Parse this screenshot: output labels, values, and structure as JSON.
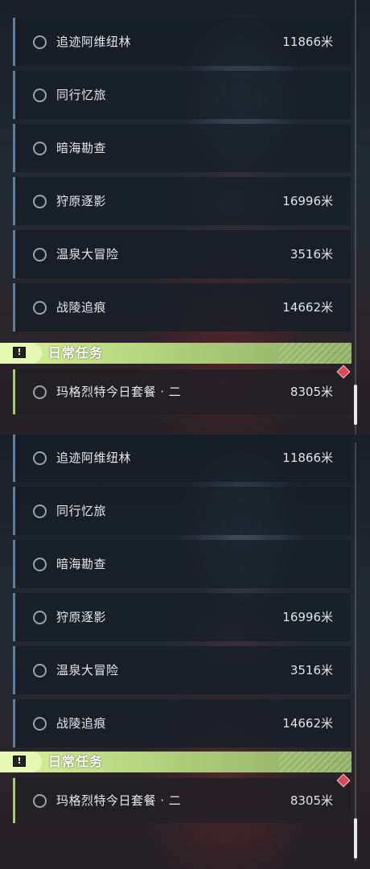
{
  "missions": [
    {
      "name": "追迹阿维纽林",
      "distance": "11866米"
    },
    {
      "name": "同行忆旅",
      "distance": ""
    },
    {
      "name": "暗海勘查",
      "distance": ""
    },
    {
      "name": "狩原逐影",
      "distance": "16996米"
    },
    {
      "name": "温泉大冒险",
      "distance": "3516米"
    },
    {
      "name": "战陵追痕",
      "distance": "14662米"
    }
  ],
  "daily": {
    "title": "日常任务",
    "icon": "exclamation-icon",
    "mission": {
      "name": "玛格烈特今日套餐 · 二",
      "distance": "8305米"
    }
  },
  "colors": {
    "accent_green": "#c9e48e",
    "row_border": "#5e7f97",
    "marker": "#d84a5a"
  }
}
